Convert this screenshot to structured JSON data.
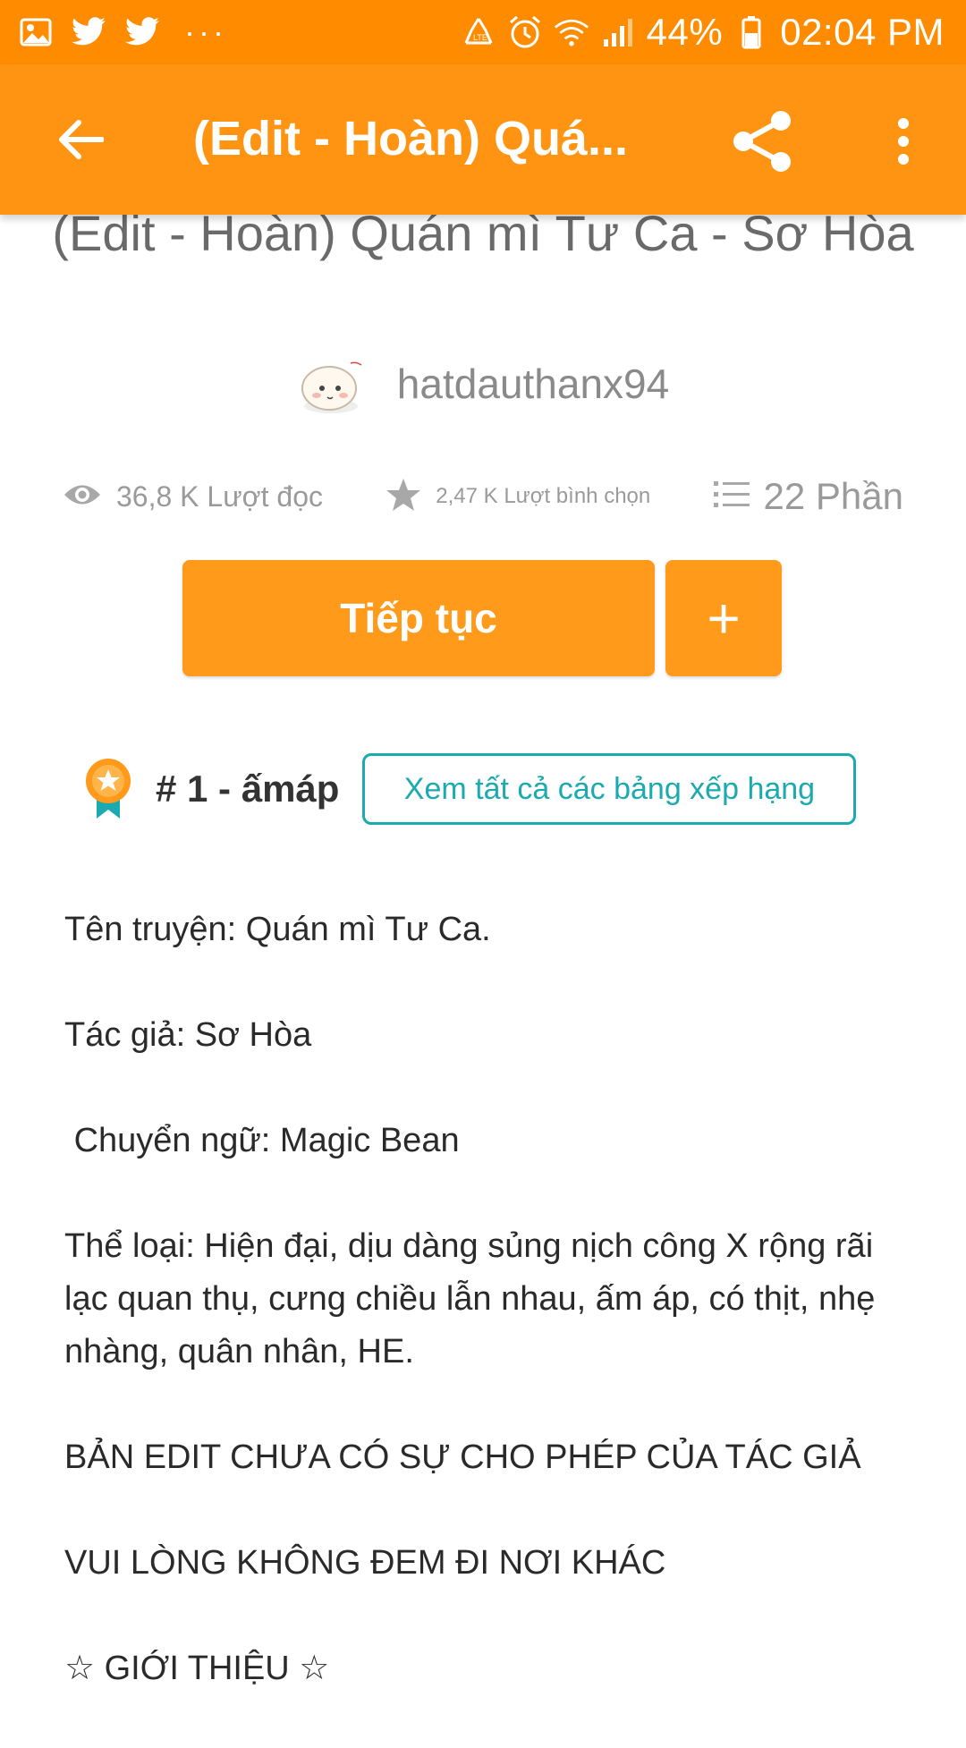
{
  "status_bar": {
    "left_icons": [
      "image-icon",
      "twitter-icon",
      "twitter-icon"
    ],
    "more": "···",
    "battery": "44%",
    "time": "02:04 PM",
    "right_icons": [
      "recycle-icon",
      "alarm-icon",
      "wifi-icon",
      "signal-icon",
      "battery-icon"
    ]
  },
  "app_bar": {
    "title": "(Edit - Hoàn) Quá...",
    "back_icon": "arrow-left-icon",
    "share_icon": "share-icon",
    "menu_icon": "more-vertical-icon",
    "color": "#ff9412"
  },
  "story": {
    "title": "(Edit - Hoàn) Quán mì Tư Ca - Sơ Hòa",
    "author": "hatdauthanx94",
    "stats": {
      "reads": "36,8 K Lượt đọc",
      "votes": "2,47 K Lượt bình chọn",
      "parts": "22 Phần"
    },
    "continue_label": "Tiếp tục",
    "add_label": "+",
    "ranking": {
      "text": "# 1 - ấmáp",
      "view_all": "Xem tất cả các bảng xếp hạng"
    },
    "description": [
      "Tên truyện: Quán mì Tư Ca.",
      "Tác giả: Sơ Hòa",
      " Chuyển ngữ: Magic Bean",
      "Thể loại: Hiện đại, dịu dàng sủng nịch công X rộng rãi lạc quan thụ, cưng chiều lẫn nhau, ấm áp, có thịt, nhẹ nhàng, quân nhân, HE.",
      "BẢN EDIT CHƯA CÓ SỰ CHO PHÉP CỦA TÁC GIẢ",
      "VUI LÒNG KHÔNG ĐEM ĐI NƠI KHÁC",
      "☆ GIỚI THIỆU ☆"
    ]
  },
  "colors": {
    "accent": "#ff9a1a",
    "status_bar": "#ff8c00",
    "teal": "#1aaab0"
  }
}
